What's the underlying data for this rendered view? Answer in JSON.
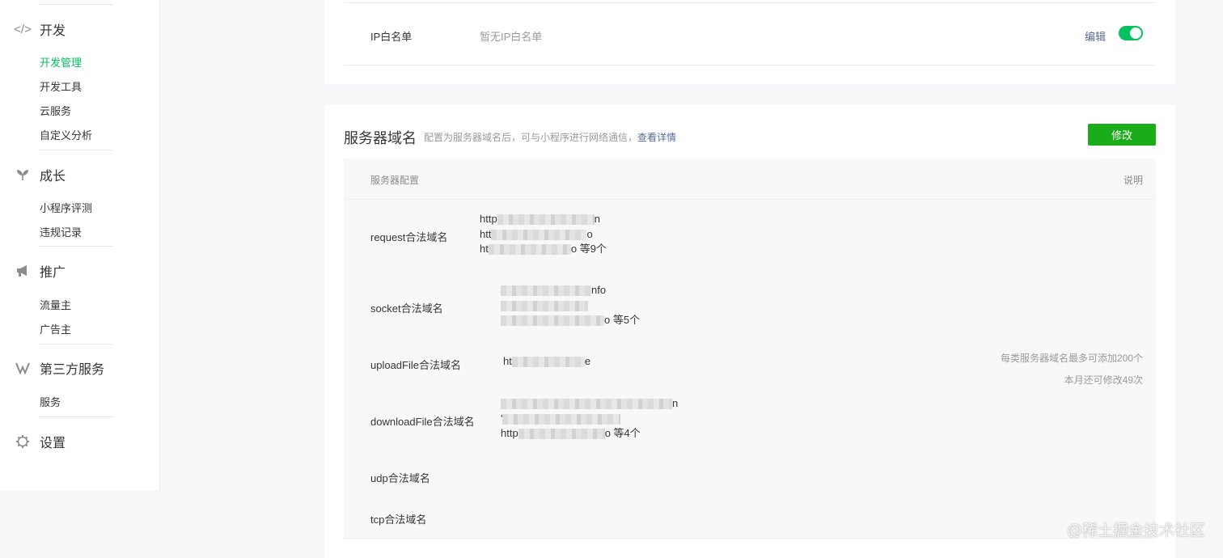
{
  "sidebar": {
    "groups": [
      {
        "label": "开发",
        "icon": "code-icon",
        "items": [
          "开发管理",
          "开发工具",
          "云服务",
          "自定义分析"
        ]
      },
      {
        "label": "成长",
        "icon": "sprout-icon",
        "items": [
          "小程序评测",
          "违规记录"
        ]
      },
      {
        "label": "推广",
        "icon": "megaphone-icon",
        "items": [
          "流量主",
          "广告主"
        ]
      },
      {
        "label": "第三方服务",
        "icon": "third-party-icon",
        "items": [
          "服务"
        ]
      },
      {
        "label": "设置",
        "icon": "gear-icon",
        "items": []
      }
    ],
    "active_item": "开发管理"
  },
  "ip_whitelist": {
    "label": "IP白名单",
    "value": "暂无IP白名单",
    "edit_label": "编辑",
    "toggle_on": true
  },
  "server_domain": {
    "title": "服务器域名",
    "description": "配置为服务器域名后，可与小程序进行网络通信，",
    "details_link": "查看详情",
    "modify_button": "修改",
    "table": {
      "header_left": "服务器配置",
      "header_right": "说明",
      "rows": [
        {
          "label": "request合法域名",
          "lines": [
            "http",
            "htt",
            "ht"
          ],
          "line_ends": [
            "n",
            "o",
            "o"
          ],
          "summary": "等9个"
        },
        {
          "label": "socket合法域名",
          "lines": [
            "",
            "",
            ""
          ],
          "line_ends": [
            "nfo",
            "",
            "o"
          ],
          "summary": "等5个"
        },
        {
          "label": "uploadFile合法域名",
          "lines": [
            "ht"
          ],
          "line_ends": [
            "e"
          ],
          "summary": ""
        },
        {
          "label": "downloadFile合法域名",
          "lines": [
            "",
            "'",
            "http"
          ],
          "line_ends": [
            "n",
            "",
            "o"
          ],
          "summary": "等4个"
        },
        {
          "label": "udp合法域名",
          "lines": [],
          "line_ends": [],
          "summary": ""
        },
        {
          "label": "tcp合法域名",
          "lines": [],
          "line_ends": [],
          "summary": ""
        }
      ],
      "notes": [
        "每类服务器域名最多可添加200个",
        "本月还可修改49次"
      ]
    }
  },
  "watermark": "@稀土掘金技术社区",
  "colors": {
    "accent_green": "#07c160",
    "button_green": "#1aad19",
    "link": "#576b95"
  }
}
